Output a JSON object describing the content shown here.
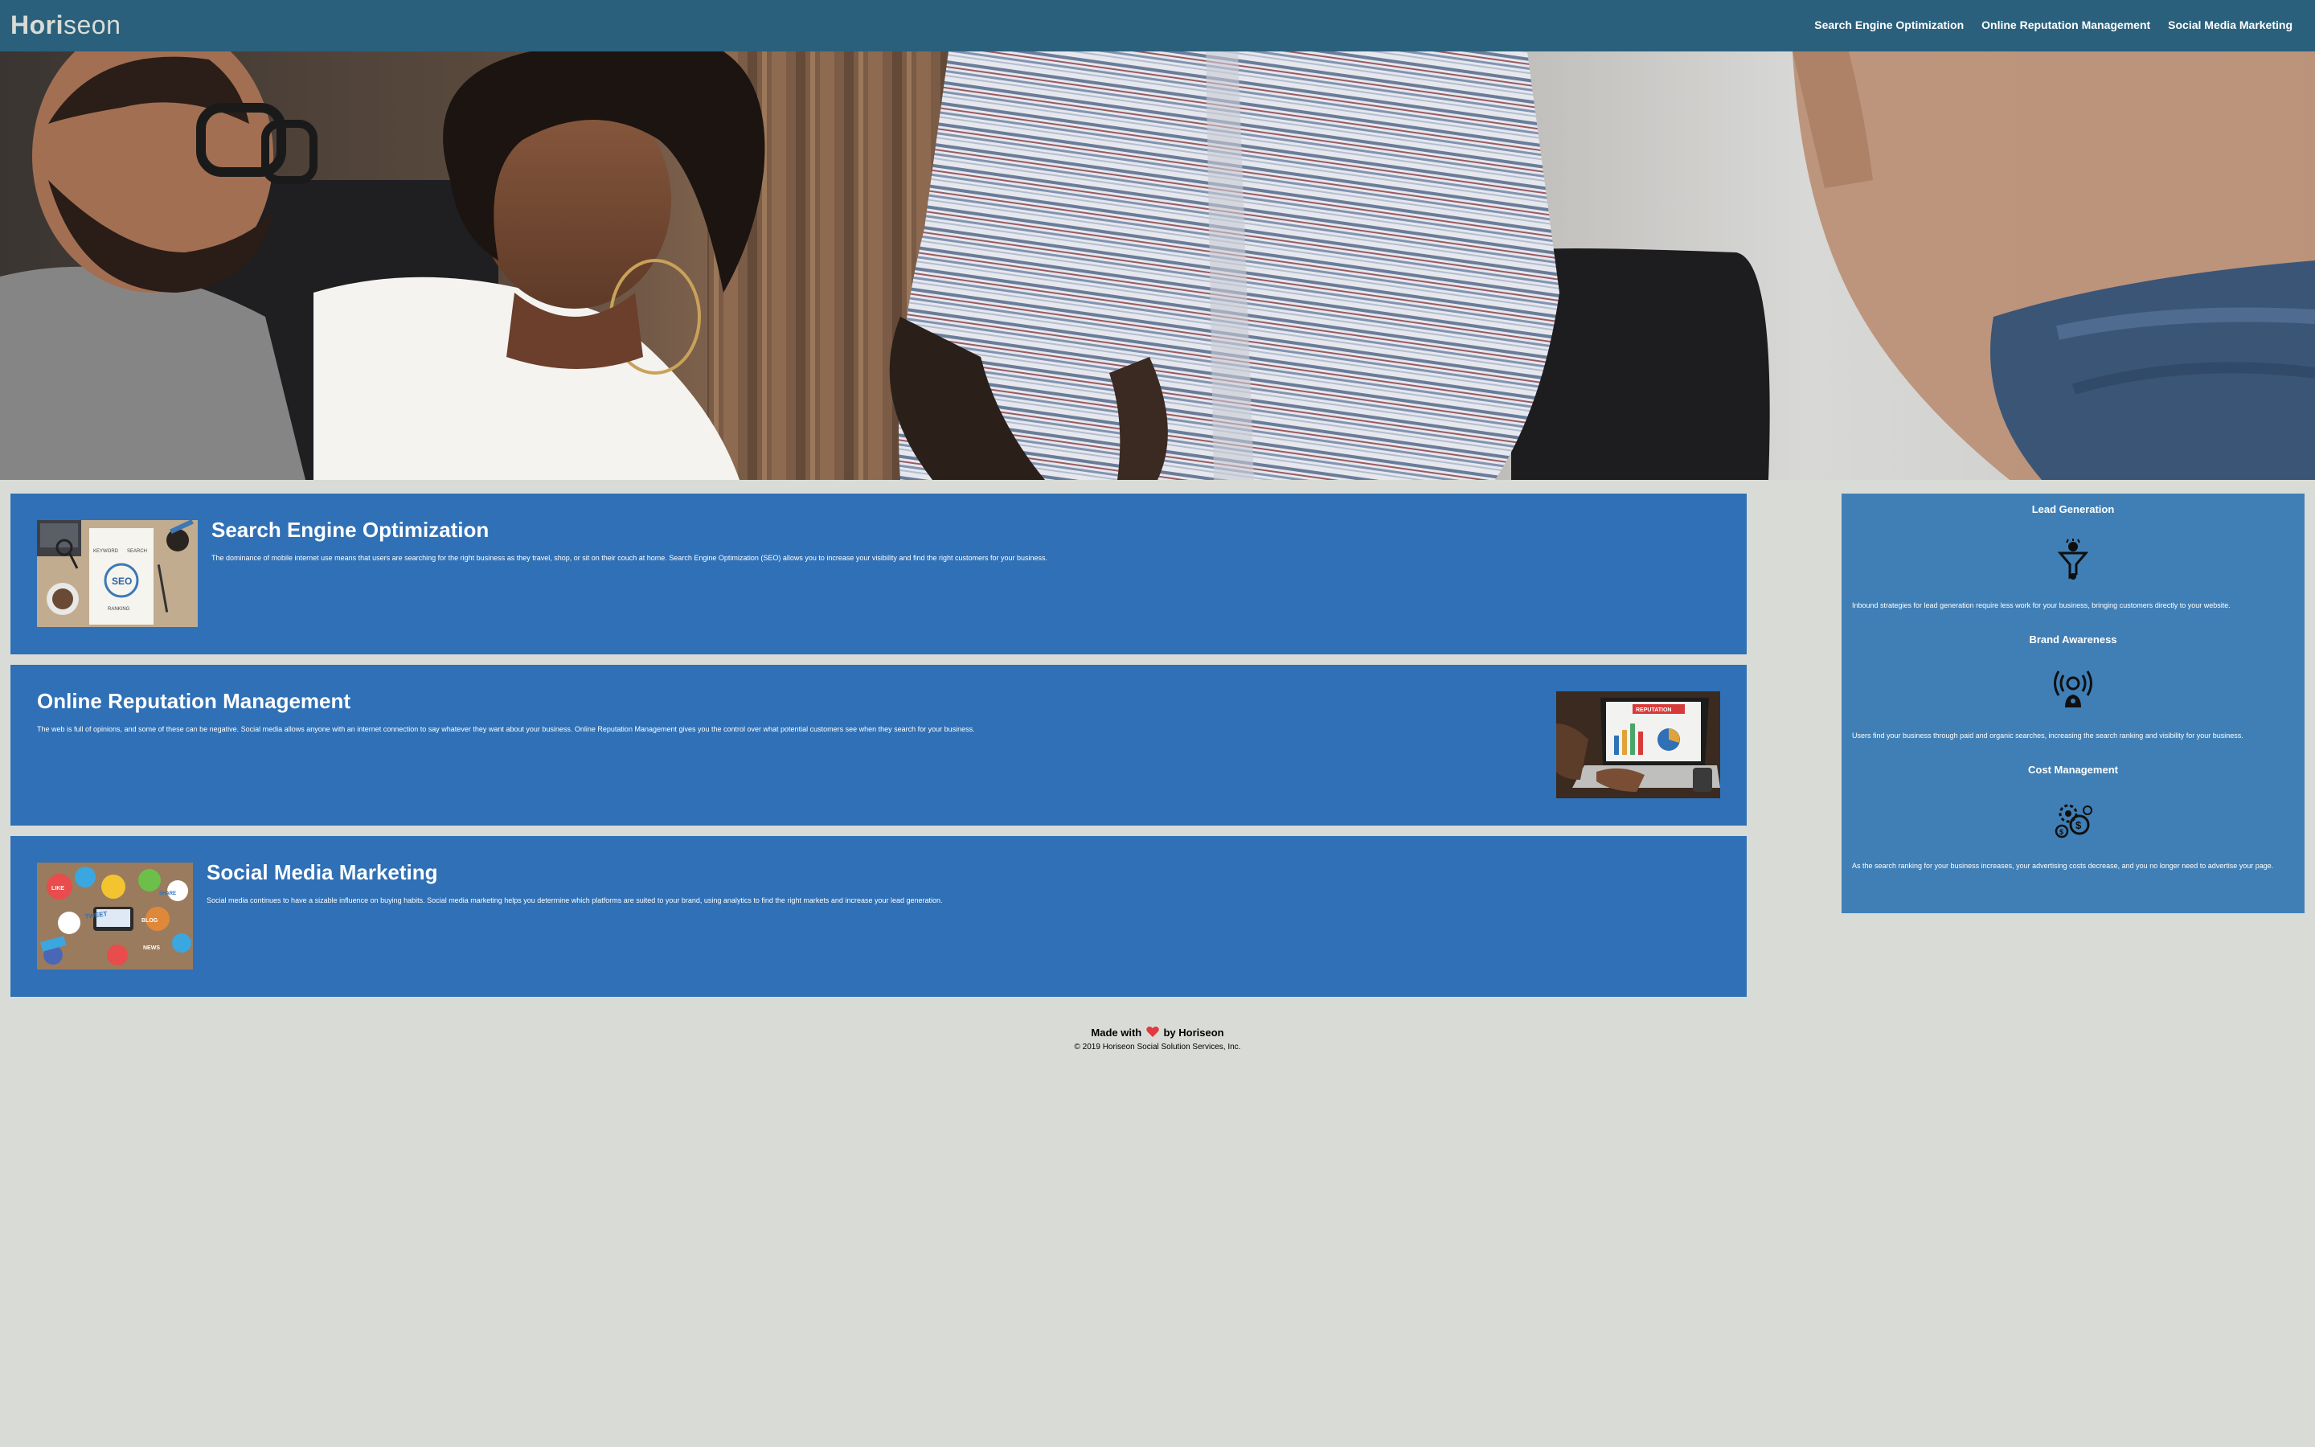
{
  "header": {
    "logo_prefix": "Hori",
    "logo_suffix": "seon",
    "nav": [
      {
        "label": "Search Engine Optimization"
      },
      {
        "label": "Online Reputation Management"
      },
      {
        "label": "Social Media Marketing"
      }
    ]
  },
  "hero": {
    "image_alt": "marketing team meeting photo"
  },
  "content": [
    {
      "title": "Search Engine Optimization",
      "text": "The dominance of mobile internet use means that users are searching for the right business as they travel, shop, or sit on their couch at home. Search Engine Optimization (SEO) allows you to increase your visibility and find the right customers for your business.",
      "image": "seo-collage-image",
      "image_words": [
        "SEO",
        "KEYWORD",
        "SEARCH",
        "RANKING"
      ]
    },
    {
      "title": "Online Reputation Management",
      "text": "The web is full of opinions, and some of these can be negative. Social media allows anyone with an internet connection to say whatever they want about your business. Online Reputation Management gives you the control over what potential customers see when they search for your business.",
      "image": "laptop-reputation-image",
      "image_words": [
        "REPUTATION"
      ]
    },
    {
      "title": "Social Media Marketing",
      "text": "Social media continues to have a sizable influence on buying habits. Social media marketing helps you determine which platforms are suited to your brand, using analytics to find the right markets and increase your lead generation.",
      "image": "social-media-desk-image",
      "image_words": [
        "TWEET",
        "LIKE",
        "BLOG",
        "SHARE",
        "NEWS"
      ]
    }
  ],
  "benefits": [
    {
      "title": "Lead Generation",
      "icon": "lead-generation-icon",
      "text": "Inbound strategies for lead generation require less work for your business, bringing customers directly to your website."
    },
    {
      "title": "Brand Awareness",
      "icon": "brand-awareness-icon",
      "text": "Users find your business through paid and organic searches, increasing the search ranking and visibility for your business."
    },
    {
      "title": "Cost Management",
      "icon": "cost-management-icon",
      "text": "As the search ranking for your business increases, your advertising costs decrease, and you no longer need to advertise your page."
    }
  ],
  "footer": {
    "made_with": "Made with",
    "by": "by Horiseon",
    "copyright": "© 2019 Horiseon Social Solution Services, Inc."
  },
  "colors": {
    "header_bg": "#2a607c",
    "card_bg": "#2f70b6",
    "sidebar_bg": "#3f7fb6",
    "page_bg": "#d9dcd6",
    "heart": "#e0393e"
  }
}
